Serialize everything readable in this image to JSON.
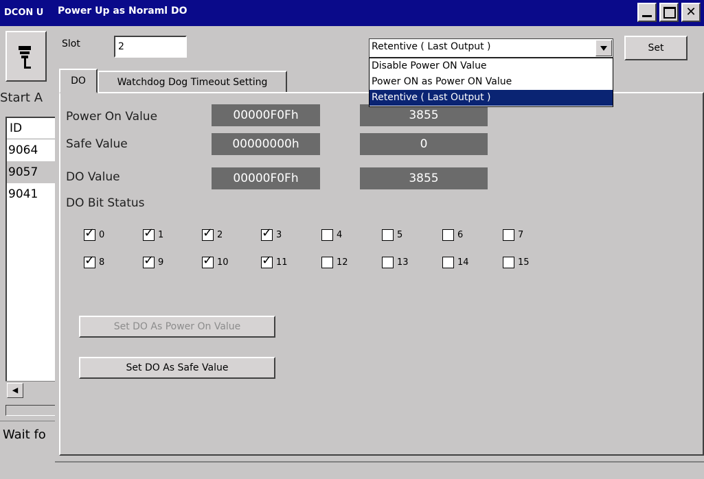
{
  "background_window": {
    "title": "DCON U",
    "start_label": "Start A",
    "list": {
      "header": "ID",
      "rows": [
        "9064",
        "9057",
        "9041"
      ],
      "selected_index": 1
    },
    "scroll_left_glyph": "◀",
    "status_text": "Wait fo"
  },
  "dialog": {
    "title": "Power Up as Noraml DO",
    "slot_label": "Slot",
    "slot_value": "2",
    "combo_value": "Retentive ( Last Output )",
    "set_label": "Set",
    "dropdown": {
      "options": [
        "Disable Power ON Value",
        "Power ON as Power ON Value",
        "Retentive ( Last Output )"
      ],
      "selected_index": 2
    },
    "tabs": [
      {
        "label": "DO",
        "active": true
      },
      {
        "label": "Watchdog Dog Timeout Setting",
        "active": false
      }
    ],
    "power_on": {
      "label": "Power On Value",
      "hex": "00000F0Fh",
      "dec": "3855"
    },
    "safe": {
      "label": "Safe Value",
      "hex": "00000000h",
      "dec": "0"
    },
    "do_value": {
      "label": "DO Value",
      "hex": "00000F0Fh",
      "dec": "3855"
    },
    "bit_status_label": "DO Bit Status",
    "bits_row1": [
      {
        "label": "0",
        "checked": true
      },
      {
        "label": "1",
        "checked": true
      },
      {
        "label": "2",
        "checked": true
      },
      {
        "label": "3",
        "checked": true
      },
      {
        "label": "4",
        "checked": false
      },
      {
        "label": "5",
        "checked": false
      },
      {
        "label": "6",
        "checked": false
      },
      {
        "label": "7",
        "checked": false
      }
    ],
    "bits_row2": [
      {
        "label": "8",
        "checked": true
      },
      {
        "label": "9",
        "checked": true
      },
      {
        "label": "10",
        "checked": true
      },
      {
        "label": "11",
        "checked": true
      },
      {
        "label": "12",
        "checked": false
      },
      {
        "label": "13",
        "checked": false
      },
      {
        "label": "14",
        "checked": false
      },
      {
        "label": "15",
        "checked": false
      }
    ],
    "btn_power_on": "Set DO As Power On Value",
    "btn_safe": "Set DO As Safe Value",
    "check_glyph": "✓",
    "close_glyph": "✕"
  },
  "colors": {
    "titlebar": "#0a0a8a",
    "face": "#c8c6c6",
    "value_box": "#6b6b6b",
    "selection": "#0a2473"
  }
}
